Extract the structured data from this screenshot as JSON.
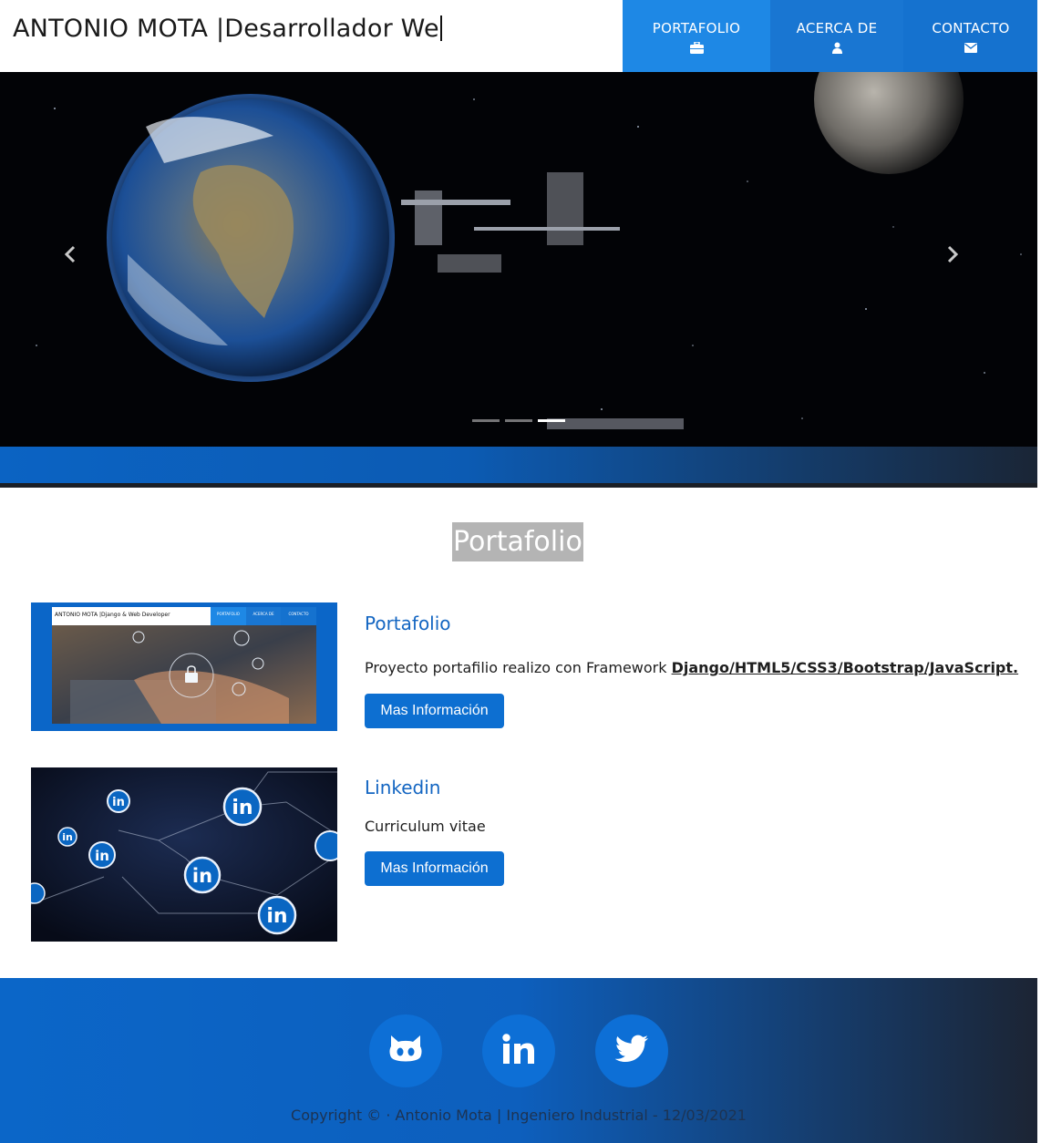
{
  "header": {
    "brand": "ANTONIO MOTA |Desarrollador We",
    "nav": [
      {
        "label": "PORTAFOLIO",
        "icon": "briefcase-icon"
      },
      {
        "label": "ACERCA DE",
        "icon": "user-icon"
      },
      {
        "label": "CONTACTO",
        "icon": "envelope-icon"
      }
    ]
  },
  "carousel": {
    "prev_icon": "chevron-left-icon",
    "next_icon": "chevron-right-icon",
    "slides": 3,
    "active_slide": 3
  },
  "portfolio": {
    "title": "Portafolio",
    "projects": [
      {
        "title": "Portafolio",
        "desc_text": "Proyecto portafilio realizo con Framework ",
        "desc_link": "Django/HTML5/CSS3/Bootstrap/JavaScript.",
        "button": "Mas Información",
        "thumb": {
          "brand": "ANTONIO MOTA |Django & Web Developer",
          "nav": [
            "PORTAFOLIO",
            "ACERCA DE",
            "CONTACTO"
          ]
        }
      },
      {
        "title": "Linkedin",
        "desc_text": "Curriculum vitae",
        "button": "Mas Información",
        "thumb_badge": "in"
      }
    ]
  },
  "footer": {
    "social": [
      "github-icon",
      "linkedin-icon",
      "twitter-icon"
    ],
    "copyright": "Copyright © · Antonio Mota | Ingeniero Industrial - 12/03/2021"
  },
  "colors": {
    "nav_portafolio": "#1e88e5",
    "nav_acerca": "#1976d2",
    "nav_contacto": "#1572cf",
    "primary_button": "#0d6fd1",
    "project_title": "#1466c2"
  }
}
